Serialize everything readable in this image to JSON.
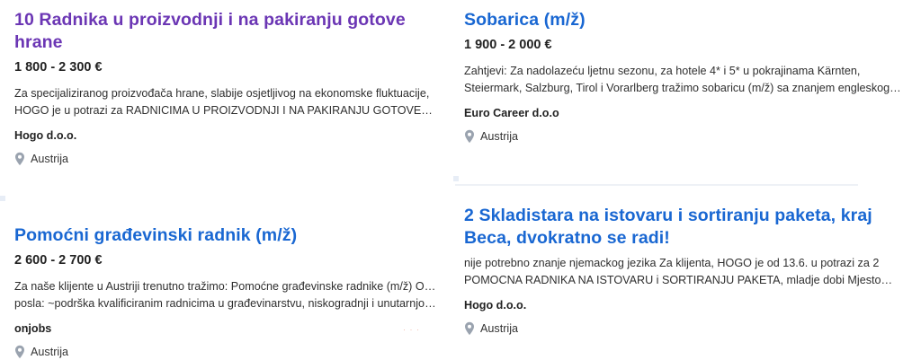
{
  "jobs": [
    {
      "title": "10 Radnika u proizvodnji i na pakiranju gotove hrane",
      "salary": "1 800 - 2 300 €",
      "desc_line1": "Za specijaliziranog proizvođača hrane, slabije osjetljivog na ekonomske fluktuacije,",
      "desc_line2": "HOGO je u potrazi za RADNICIMA U PROIZVODNJI I NA PAKIRANJU GOTOVE…",
      "company": "Hogo d.o.o.",
      "location": "Austrija",
      "title_color": "#6b36b4"
    },
    {
      "title": "Sobarica (m/ž)",
      "salary": "1 900 - 2 000 €",
      "desc_line1": "Zahtjevi: Za nadolazeću ljetnu sezonu, za hotele 4* i 5* u pokrajinama Kärnten,",
      "desc_line2": "Steiermark, Salzburg, Tirol i Vorarlberg tražimo sobaricu (m/ž) sa znanjem engleskog…",
      "company": "Euro Career d.o.o",
      "location": "Austrija",
      "title_color": "#1967d2"
    },
    {
      "title": "Pomoćni građevinski radnik (m/ž)",
      "salary": "2 600 - 2 700 €",
      "desc_line1": "Za naše klijente u Austriji trenutno tražimo: Pomoćne građevinske radnike (m/ž) Opis",
      "desc_line2": "posla: ~podrška kvalificiranim radnicima u građevinarstvu, niskogradnji i unutarnjoj…",
      "company": "onjobs",
      "location": "Austrija",
      "title_color": "#1967d2"
    },
    {
      "title": "2 Skladistara na istovaru i sortiranju paketa, kraj Beca, dvokratno se radi!",
      "salary": "",
      "desc_line1": "nije potrebno znanje njemackog jezika Za klijenta, HOGO je od 13.6. u potrazi za 2",
      "desc_line2": "POMOCNA RADNIKA NA ISTOVARU i SORTIRANJU PAKETA, mladje dobi Mjesto…",
      "company": "Hogo d.o.o.",
      "location": "Austrija",
      "title_color": "#1967d2"
    }
  ],
  "icons": {
    "location": "map-pin-icon"
  }
}
